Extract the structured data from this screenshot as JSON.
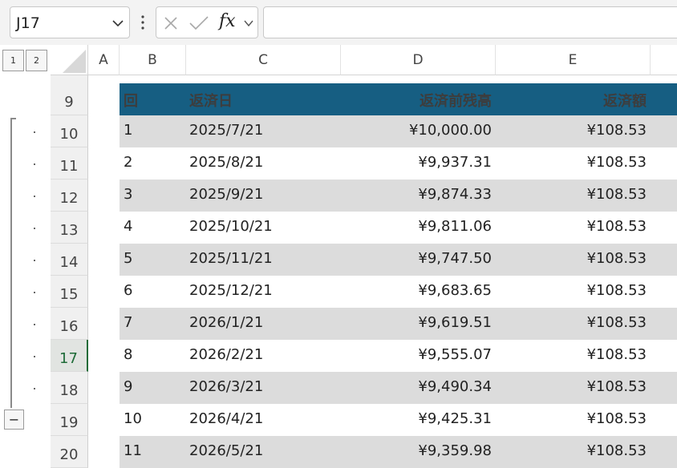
{
  "name_box": {
    "value": "J17"
  },
  "formula_bar": {
    "fx_label": "fx",
    "value": ""
  },
  "outline": {
    "levels": [
      "1",
      "2"
    ],
    "collapse_label": "−"
  },
  "columns": [
    "A",
    "B",
    "C",
    "D",
    "E"
  ],
  "active_row": "17",
  "header_row": {
    "row_number": "9",
    "no": "回",
    "date": "返済日",
    "balance": "返済前残高",
    "payment": "返済額"
  },
  "rows": [
    {
      "row_number": "10",
      "no": "1",
      "date": "2025/7/21",
      "balance": "¥10,000.00",
      "payment": "¥108.53"
    },
    {
      "row_number": "11",
      "no": "2",
      "date": "2025/8/21",
      "balance": "¥9,937.31",
      "payment": "¥108.53"
    },
    {
      "row_number": "12",
      "no": "3",
      "date": "2025/9/21",
      "balance": "¥9,874.33",
      "payment": "¥108.53"
    },
    {
      "row_number": "13",
      "no": "4",
      "date": "2025/10/21",
      "balance": "¥9,811.06",
      "payment": "¥108.53"
    },
    {
      "row_number": "14",
      "no": "5",
      "date": "2025/11/21",
      "balance": "¥9,747.50",
      "payment": "¥108.53"
    },
    {
      "row_number": "15",
      "no": "6",
      "date": "2025/12/21",
      "balance": "¥9,683.65",
      "payment": "¥108.53"
    },
    {
      "row_number": "16",
      "no": "7",
      "date": "2026/1/21",
      "balance": "¥9,619.51",
      "payment": "¥108.53"
    },
    {
      "row_number": "17",
      "no": "8",
      "date": "2026/2/21",
      "balance": "¥9,555.07",
      "payment": "¥108.53"
    },
    {
      "row_number": "18",
      "no": "9",
      "date": "2026/3/21",
      "balance": "¥9,490.34",
      "payment": "¥108.53"
    },
    {
      "row_number": "19",
      "no": "10",
      "date": "2026/4/21",
      "balance": "¥9,425.31",
      "payment": "¥108.53"
    },
    {
      "row_number": "20",
      "no": "11",
      "date": "2026/5/21",
      "balance": "¥9,359.98",
      "payment": "¥108.53"
    }
  ],
  "colors": {
    "header_fill": "#165e82",
    "band_fill": "#dcdcdc",
    "active_accent": "#1e6b38"
  }
}
